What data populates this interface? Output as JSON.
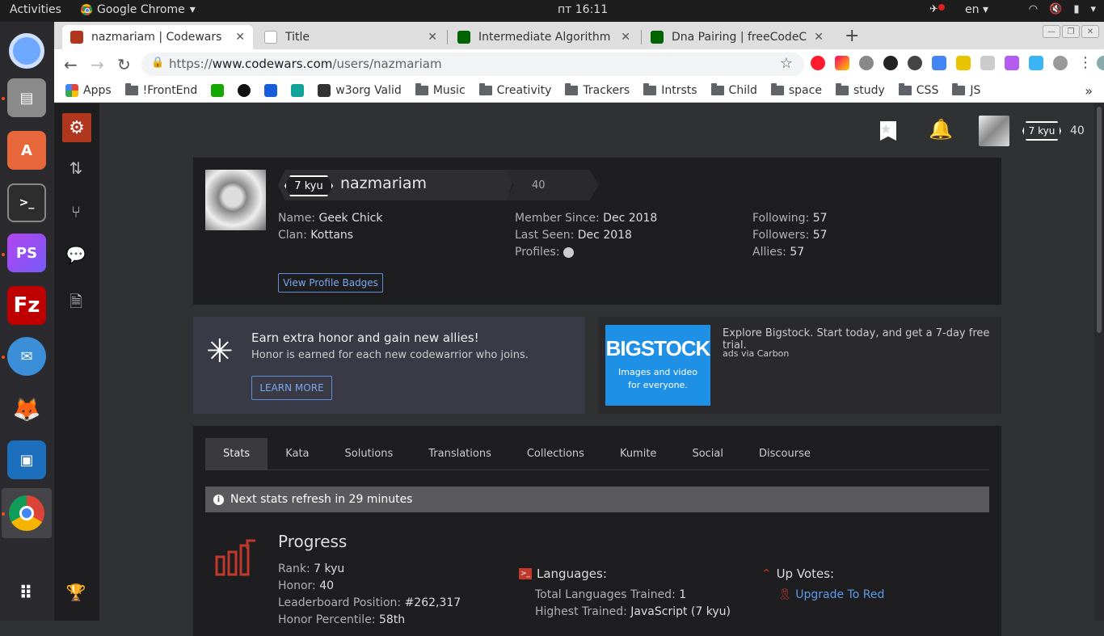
{
  "system": {
    "activities": "Activities",
    "app_name": "Google Chrome",
    "clock": "пт 16:11",
    "lang": "en"
  },
  "tabs": [
    {
      "title": "nazmariam | Codewars",
      "fav_color": "#b1361e"
    },
    {
      "title": "Title",
      "fav_color": "#ffffff"
    },
    {
      "title": "Intermediate Algorithm S",
      "fav_color": "#006400"
    },
    {
      "title": "Dna Pairing | freeCodeCar",
      "fav_color": "#006400"
    }
  ],
  "omnibox": {
    "url_prefix": "https://",
    "url_host": "www.codewars.com",
    "url_path": "/users/nazmariam"
  },
  "bookmarks": [
    {
      "label": "Apps",
      "icon": "apps-grid-icon"
    },
    {
      "label": "!FrontEnd",
      "icon": "folder-icon"
    },
    {
      "label": "",
      "icon": "upwork-icon"
    },
    {
      "label": "",
      "icon": "github-icon"
    },
    {
      "label": "",
      "icon": "bitwarden-icon"
    },
    {
      "label": "",
      "icon": "replit-icon"
    },
    {
      "label": "w3org Valid",
      "icon": "w3-icon"
    },
    {
      "label": "Music",
      "icon": "folder-icon"
    },
    {
      "label": "Creativity",
      "icon": "folder-icon"
    },
    {
      "label": "Trackers",
      "icon": "folder-icon"
    },
    {
      "label": "Intrsts",
      "icon": "folder-icon"
    },
    {
      "label": "Child",
      "icon": "folder-icon"
    },
    {
      "label": "space",
      "icon": "folder-icon"
    },
    {
      "label": "study",
      "icon": "folder-icon"
    },
    {
      "label": "CSS",
      "icon": "folder-icon"
    },
    {
      "label": "JS",
      "icon": "folder-icon"
    }
  ],
  "header": {
    "rank": "7 kyu",
    "honor": "40"
  },
  "profile": {
    "rank": "7 kyu",
    "username": "nazmariam",
    "honor": "40",
    "name_label": "Name:",
    "name": "Geek Chick",
    "clan_label": "Clan:",
    "clan": "Kottans",
    "member_since_label": "Member Since:",
    "member_since": "Dec 2018",
    "last_seen_label": "Last Seen:",
    "last_seen": "Dec 2018",
    "profiles_label": "Profiles:",
    "following_label": "Following:",
    "following": "57",
    "followers_label": "Followers:",
    "followers": "57",
    "allies_label": "Allies:",
    "allies": "57",
    "badges_button": "View Profile Badges"
  },
  "promo": {
    "title": "Earn extra honor and gain new allies!",
    "text": "Honor is earned for each new codewarrior who joins.",
    "button": "LEARN MORE"
  },
  "ad": {
    "brand": "BIGSTOCK",
    "tagline_1": "Images and video",
    "tagline_2": "for everyone.",
    "text": "Explore Bigstock. Start today, and get a 7-day free trial.",
    "via": "ads via Carbon"
  },
  "stats_tabs": [
    "Stats",
    "Kata",
    "Solutions",
    "Translations",
    "Collections",
    "Kumite",
    "Social",
    "Discourse"
  ],
  "notice": "Next stats refresh in 29 minutes",
  "progress": {
    "title": "Progress",
    "rank_label": "Rank:",
    "rank": "7 kyu",
    "honor_label": "Honor:",
    "honor": "40",
    "leaderboard_label": "Leaderboard Position:",
    "leaderboard": "#262,317",
    "percentile_label": "Honor Percentile:",
    "percentile": "58th"
  },
  "languages": {
    "title": "Languages:",
    "total_label": "Total Languages Trained:",
    "total": "1",
    "highest_label": "Highest Trained:",
    "highest": "JavaScript (7 kyu)"
  },
  "upvotes": {
    "title": "Up Votes:",
    "link": "Upgrade To Red"
  },
  "colors": {
    "brand_red": "#b1361e",
    "link_blue": "#5f9ae8"
  }
}
